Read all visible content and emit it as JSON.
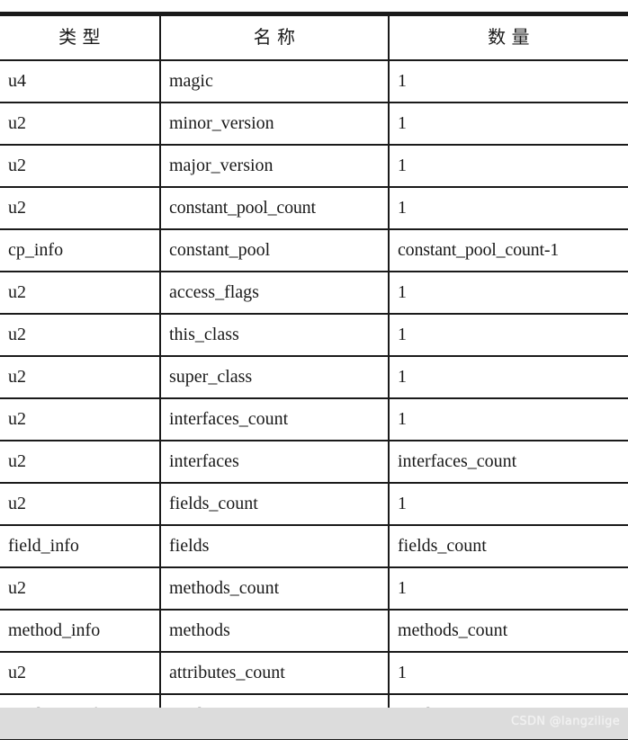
{
  "table": {
    "headers": [
      "类  型",
      "名  称",
      "数  量"
    ],
    "rows": [
      {
        "type": "u4",
        "name": "magic",
        "qty": "1"
      },
      {
        "type": "u2",
        "name": "minor_version",
        "qty": "1"
      },
      {
        "type": "u2",
        "name": "major_version",
        "qty": "1"
      },
      {
        "type": "u2",
        "name": "constant_pool_count",
        "qty": "1"
      },
      {
        "type": "cp_info",
        "name": "constant_pool",
        "qty": "constant_pool_count-1"
      },
      {
        "type": "u2",
        "name": "access_flags",
        "qty": "1"
      },
      {
        "type": "u2",
        "name": "this_class",
        "qty": "1"
      },
      {
        "type": "u2",
        "name": "super_class",
        "qty": "1"
      },
      {
        "type": "u2",
        "name": "interfaces_count",
        "qty": "1"
      },
      {
        "type": "u2",
        "name": "interfaces",
        "qty": "interfaces_count"
      },
      {
        "type": "u2",
        "name": "fields_count",
        "qty": "1"
      },
      {
        "type": "field_info",
        "name": "fields",
        "qty": "fields_count"
      },
      {
        "type": "u2",
        "name": "methods_count",
        "qty": "1"
      },
      {
        "type": "method_info",
        "name": "methods",
        "qty": "methods_count"
      },
      {
        "type": "u2",
        "name": "attributes_count",
        "qty": "1"
      },
      {
        "type": "attribute_info",
        "name": "attributes",
        "qty": "attributes_count"
      }
    ]
  },
  "footer": {
    "watermark": "CSDN @langzilige"
  },
  "colors": {
    "rule": "#1a1a1a",
    "page_background": "#ffffff",
    "footer_background": "#dcdcdc",
    "watermark_text": "#f2f2f2"
  }
}
